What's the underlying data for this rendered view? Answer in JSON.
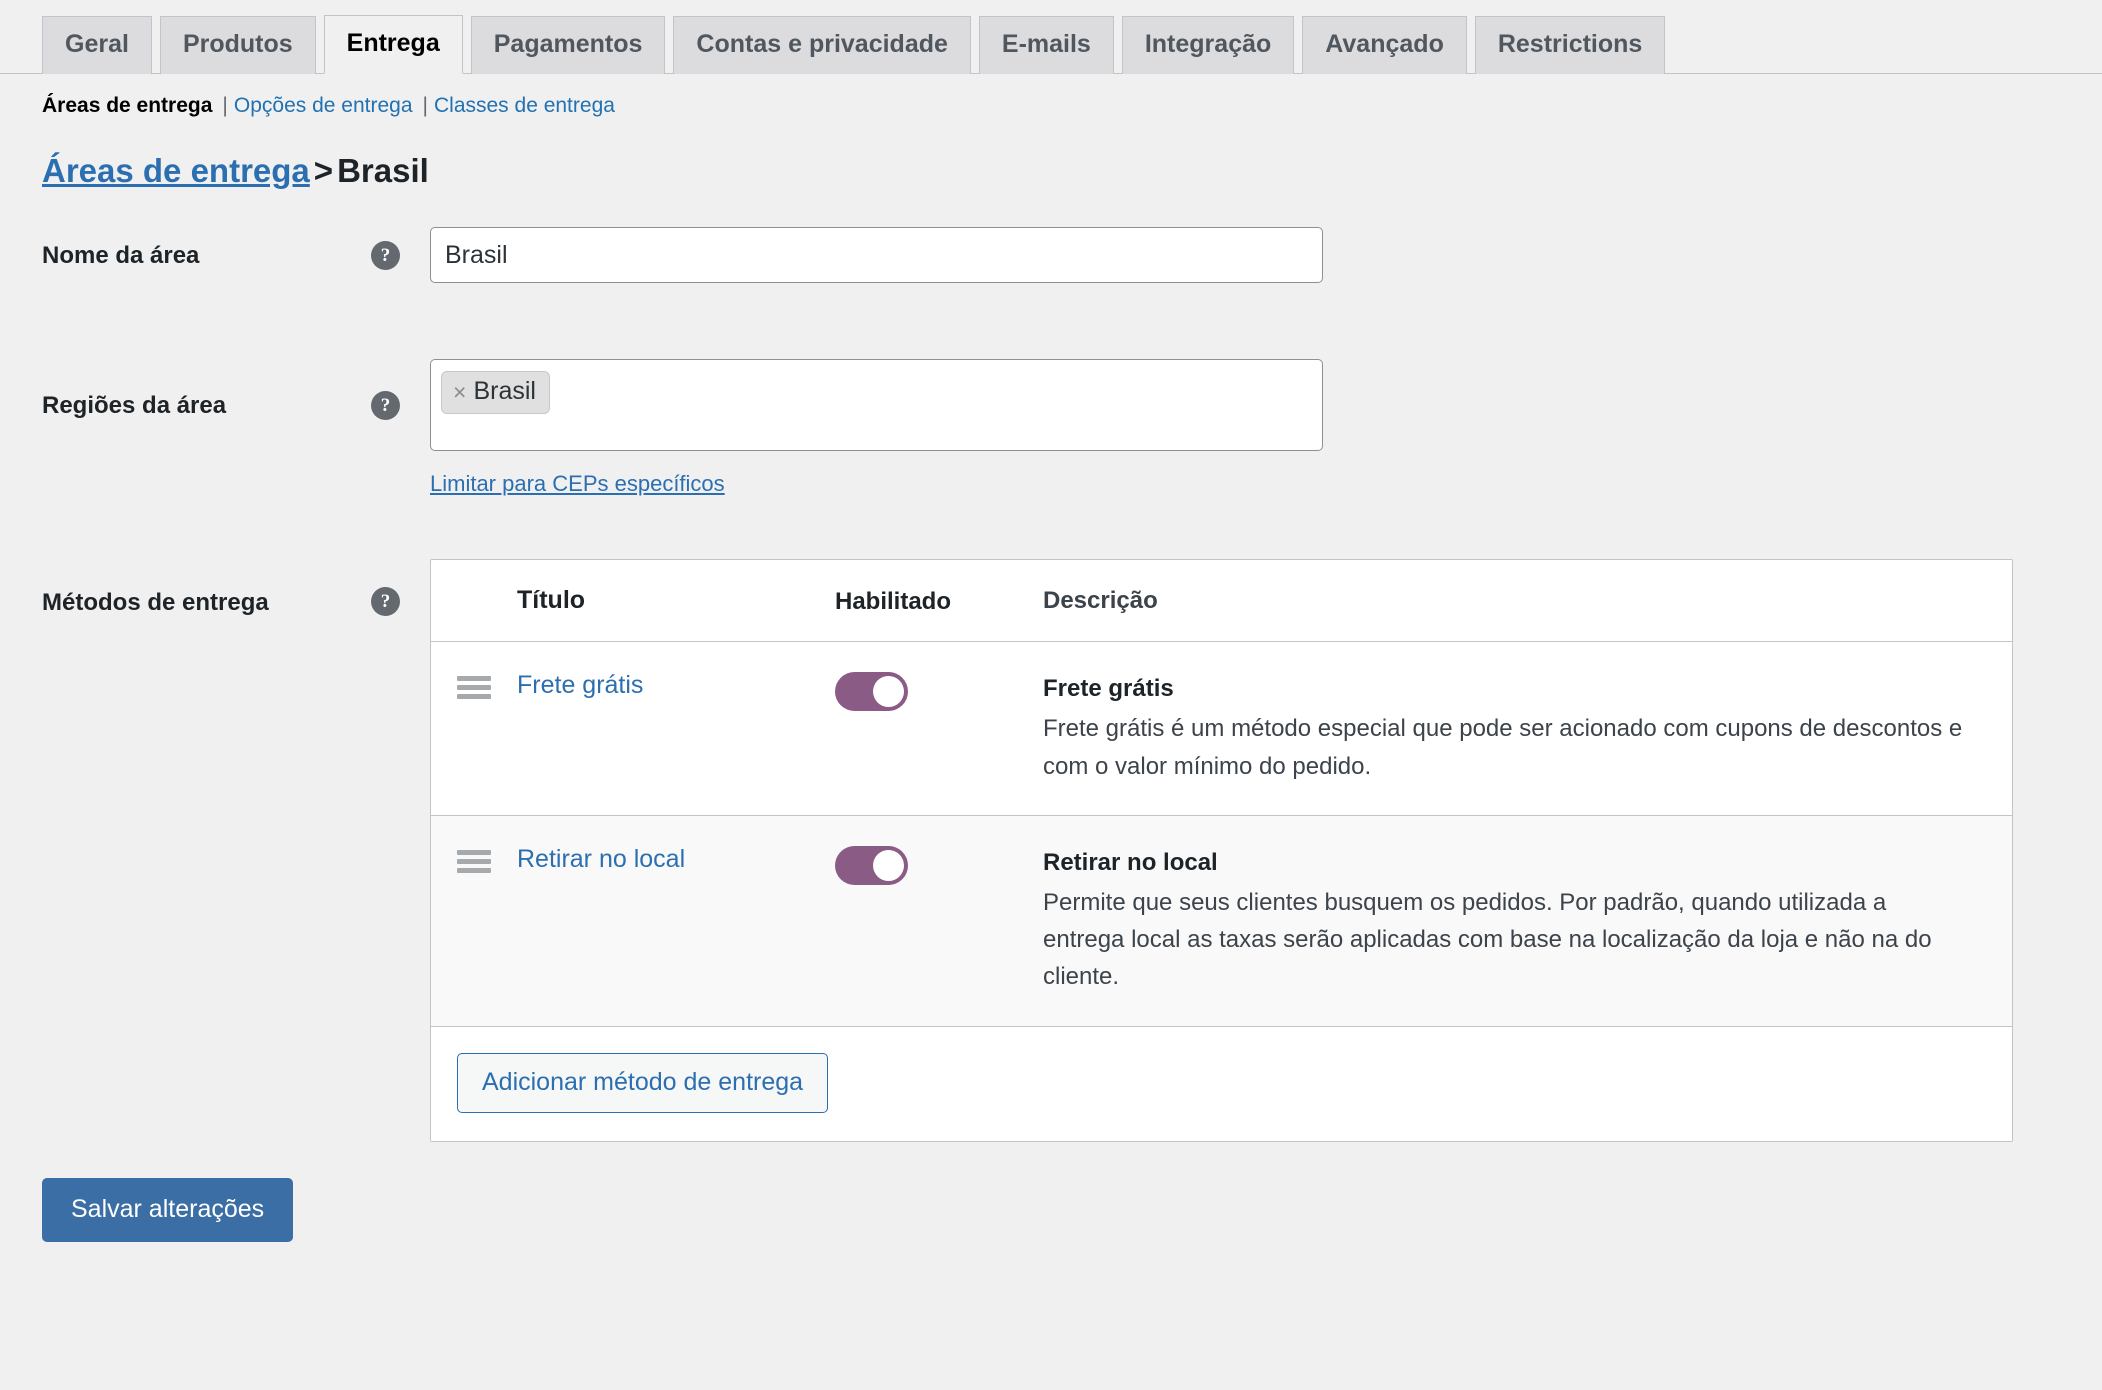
{
  "tabs": [
    {
      "label": "Geral",
      "active": false
    },
    {
      "label": "Produtos",
      "active": false
    },
    {
      "label": "Entrega",
      "active": true
    },
    {
      "label": "Pagamentos",
      "active": false
    },
    {
      "label": "Contas e privacidade",
      "active": false
    },
    {
      "label": "E-mails",
      "active": false
    },
    {
      "label": "Integração",
      "active": false
    },
    {
      "label": "Avançado",
      "active": false
    },
    {
      "label": "Restrictions",
      "active": false
    }
  ],
  "subnav": {
    "current": "Áreas de entrega",
    "sep1": "|",
    "link1": "Opções de entrega",
    "sep2": "|",
    "link2": "Classes de entrega"
  },
  "breadcrumb": {
    "parent": "Áreas de entrega",
    "separator": ">",
    "current": "Brasil"
  },
  "form": {
    "zone_name": {
      "label": "Nome da área",
      "help_icon": "help-icon",
      "value": "Brasil",
      "placeholder": ""
    },
    "zone_regions": {
      "label": "Regiões da área",
      "help_icon": "help-icon",
      "tags": [
        {
          "remove_icon": "×",
          "label": "Brasil"
        }
      ],
      "limit_link": "Limitar para CEPs específicos"
    },
    "shipping_methods": {
      "label": "Métodos de entrega",
      "help_icon": "help-icon",
      "columns": {
        "handle": "",
        "title": "Título",
        "enabled": "Habilitado",
        "description": "Descrição"
      },
      "rows": [
        {
          "handle_icon": "drag-handle-icon",
          "title": "Frete grátis",
          "enabled": true,
          "desc_title": "Frete grátis",
          "desc_body": "Frete grátis é um método especial que pode ser acionado com cupons de descontos e com o valor mínimo do pedido."
        },
        {
          "handle_icon": "drag-handle-icon",
          "title": "Retirar no local",
          "enabled": true,
          "desc_title": "Retirar no local",
          "desc_body": "Permite que seus clientes busquem os pedidos. Por padrão, quando utilizada a entrega local as taxas serão aplicadas com base na localização da loja e não na do cliente."
        }
      ],
      "add_method_label": "Adicionar método de entrega"
    }
  },
  "save_label": "Salvar alterações",
  "colors": {
    "page_background": "#f0f0f1",
    "link": "#2c6fb0",
    "primary_button": "#3a6ea5",
    "toggle_on": "#8a5b84",
    "tab_inactive": "#dcdcde",
    "border": "#c3c4c7"
  }
}
